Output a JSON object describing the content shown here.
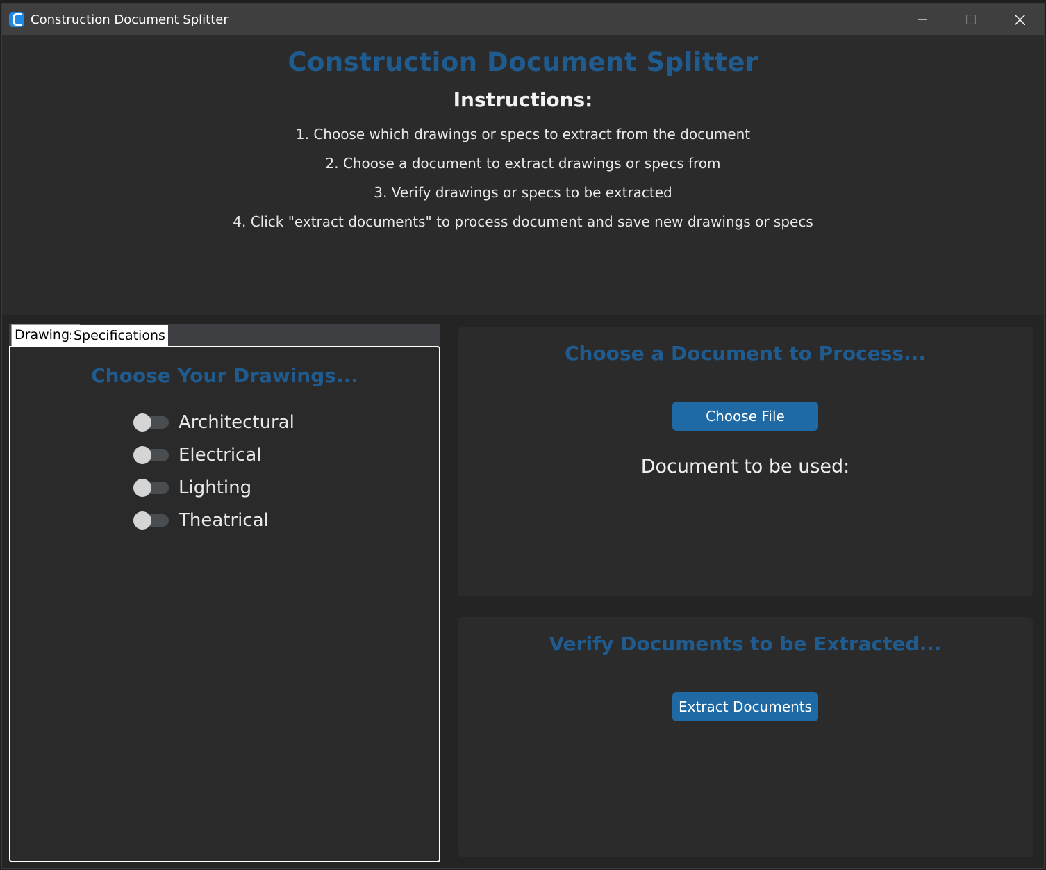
{
  "window": {
    "title": "Construction Document Splitter",
    "controls": {
      "minimize": "—",
      "maximize": "☐",
      "close": "✕"
    }
  },
  "header": {
    "app_heading": "Construction Document Splitter",
    "instructions_title": "Instructions:",
    "instructions": [
      "1. Choose which drawings or specs to extract from the document",
      "2. Choose a document to extract drawings or specs from",
      "3. Verify drawings or specs to be extracted",
      "4. Click \"extract documents\" to process document and save new drawings or specs"
    ]
  },
  "tabs": {
    "items": [
      {
        "label": "Drawings",
        "active": true
      },
      {
        "label": "Specifications",
        "active": false
      }
    ],
    "panel_heading": "Choose Your Drawings...",
    "switches": [
      {
        "label": "Architectural",
        "on": false
      },
      {
        "label": "Electrical",
        "on": false
      },
      {
        "label": "Lighting",
        "on": false
      },
      {
        "label": "Theatrical",
        "on": false
      }
    ]
  },
  "choose_card": {
    "heading": "Choose a Document to Process...",
    "button_label": "Choose File",
    "document_label": "Document to be used:"
  },
  "verify_card": {
    "heading": "Verify Documents to be Extracted...",
    "button_label": "Extract Documents"
  },
  "colors": {
    "accent_heading": "#1f5b8f",
    "button": "#1f6aa5",
    "titlebar": "#3f3f3f",
    "background": "#2b2b2b"
  }
}
